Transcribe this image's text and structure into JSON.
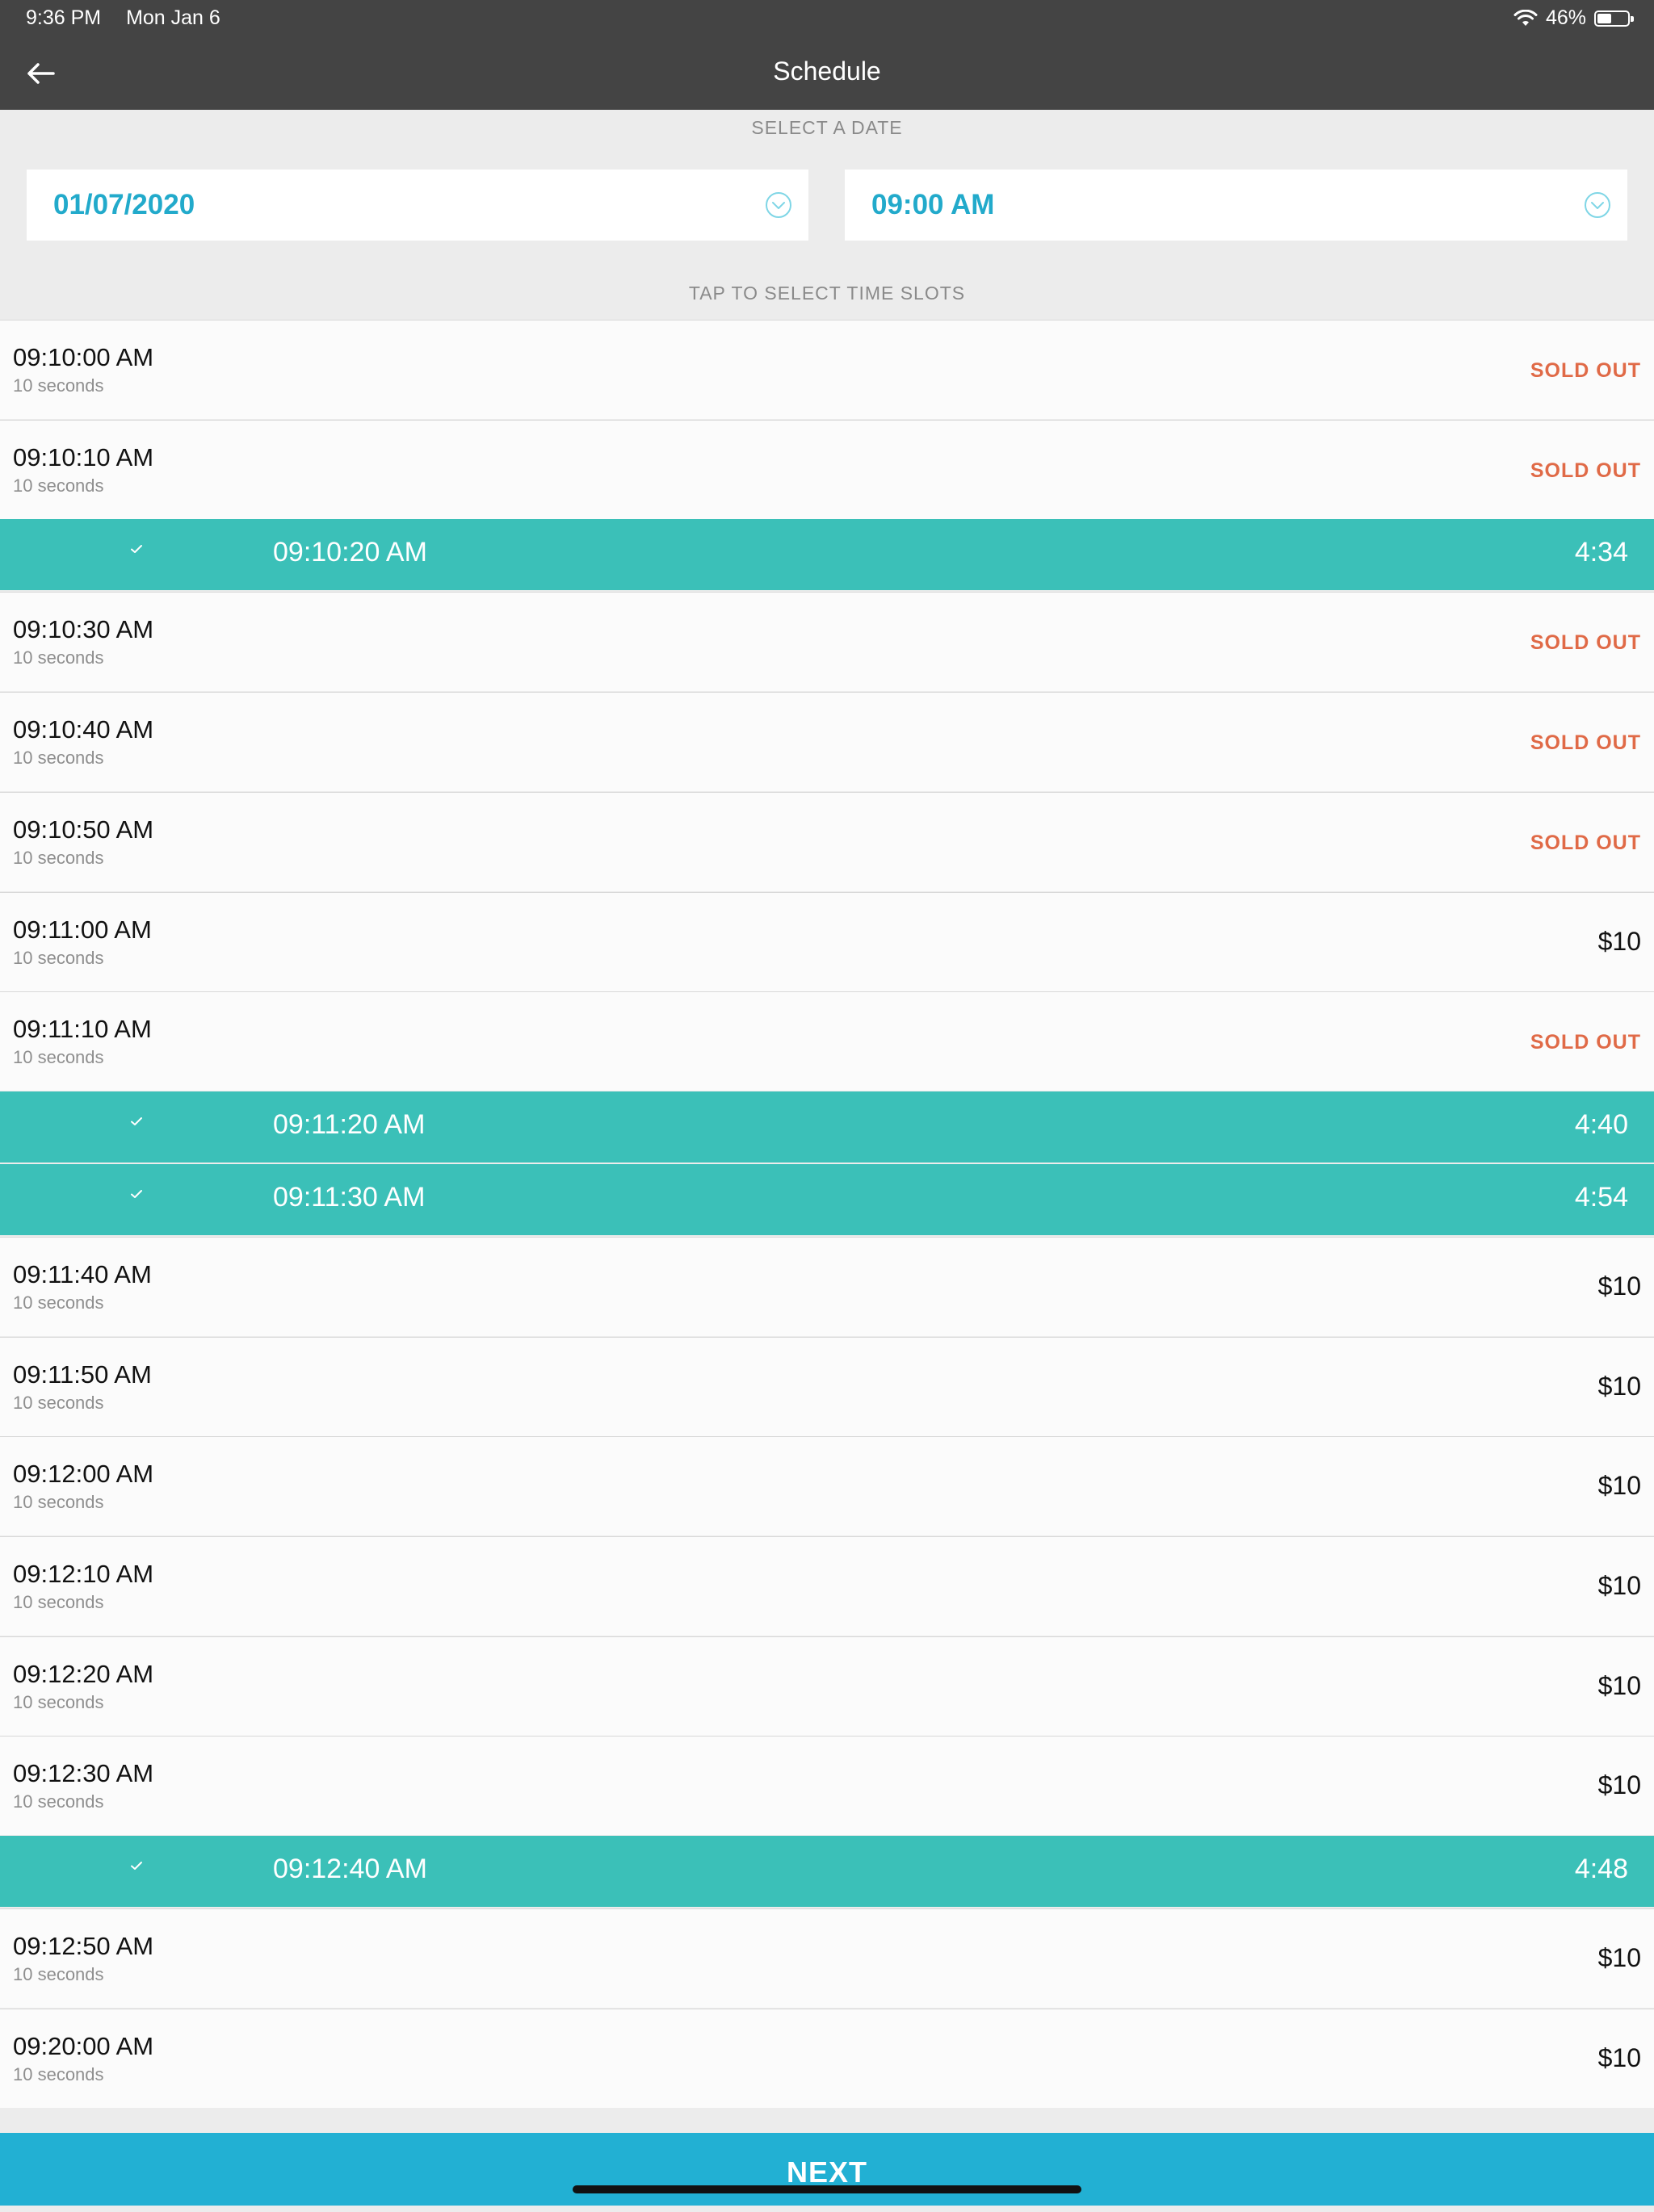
{
  "status_bar": {
    "time": "9:36 PM",
    "date": "Mon Jan 6",
    "battery": "46%",
    "battery_level": 0.46
  },
  "nav": {
    "title": "Schedule"
  },
  "date_section_label": "SELECT A DATE",
  "date_picker": {
    "value": "01/07/2020"
  },
  "time_picker": {
    "value": "09:00 AM"
  },
  "slots_section_label": "TAP TO SELECT TIME SLOTS",
  "slots": [
    {
      "time": "09:10:00 AM",
      "duration": "10 seconds",
      "status": "SOLD OUT"
    },
    {
      "time": "09:10:10 AM",
      "duration": "10 seconds",
      "status": "SOLD OUT"
    },
    {
      "time": "09:10:20 AM",
      "selected": true,
      "countdown": "4:34"
    },
    {
      "time": "09:10:30 AM",
      "duration": "10 seconds",
      "status": "SOLD OUT"
    },
    {
      "time": "09:10:40 AM",
      "duration": "10 seconds",
      "status": "SOLD OUT"
    },
    {
      "time": "09:10:50 AM",
      "duration": "10 seconds",
      "status": "SOLD OUT"
    },
    {
      "time": "09:11:00 AM",
      "duration": "10 seconds",
      "price": "$10"
    },
    {
      "time": "09:11:10 AM",
      "duration": "10 seconds",
      "status": "SOLD OUT"
    },
    {
      "time": "09:11:20 AM",
      "selected": true,
      "countdown": "4:40"
    },
    {
      "time": "09:11:30 AM",
      "selected": true,
      "countdown": "4:54"
    },
    {
      "time": "09:11:40 AM",
      "duration": "10 seconds",
      "price": "$10"
    },
    {
      "time": "09:11:50 AM",
      "duration": "10 seconds",
      "price": "$10"
    },
    {
      "time": "09:12:00 AM",
      "duration": "10 seconds",
      "price": "$10"
    },
    {
      "time": "09:12:10 AM",
      "duration": "10 seconds",
      "price": "$10"
    },
    {
      "time": "09:12:20 AM",
      "duration": "10 seconds",
      "price": "$10"
    },
    {
      "time": "09:12:30 AM",
      "duration": "10 seconds",
      "price": "$10"
    },
    {
      "time": "09:12:40 AM",
      "selected": true,
      "countdown": "4:48"
    },
    {
      "time": "09:12:50 AM",
      "duration": "10 seconds",
      "price": "$10"
    },
    {
      "time": "09:20:00 AM",
      "duration": "10 seconds",
      "price": "$10"
    }
  ],
  "next_button": {
    "label": "NEXT"
  },
  "colors": {
    "accent_teal": "#3bc0b8",
    "accent_blue": "#22b0d3",
    "sold_out": "#e06a47",
    "header_bg": "#444444"
  }
}
